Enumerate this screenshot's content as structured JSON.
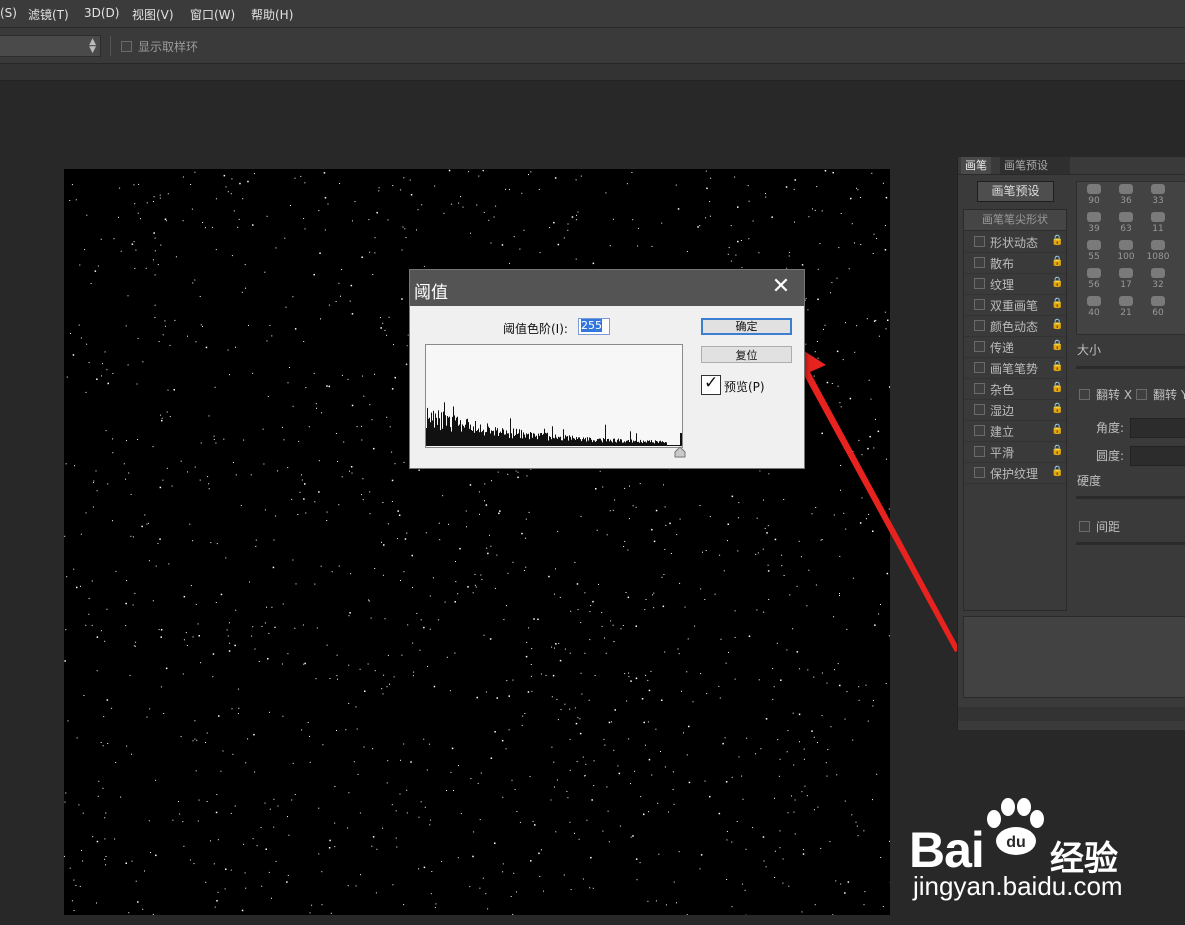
{
  "menu": [
    "(S)",
    "滤镜(T)",
    "3D(D)",
    "视图(V)",
    "窗口(W)",
    "帮助(H)"
  ],
  "options_bar": {
    "show_sampling_ring": "显示取样环"
  },
  "dialog": {
    "title": "阈值",
    "close_glyph": "✕",
    "level_label": "阈值色阶(I):",
    "level_value": "255",
    "ok_label": "确定",
    "reset_label": "复位",
    "preview_label": "预览(P)",
    "preview_checked": true,
    "check_glyph": "✓"
  },
  "brush_panel": {
    "tabs": [
      "画笔",
      "画笔预设"
    ],
    "preset_button": "画笔预设",
    "tip_shape_header": "画笔笔尖形状",
    "options": [
      "形状动态",
      "散布",
      "纹理",
      "双重画笔",
      "颜色动态",
      "传递",
      "画笔笔势",
      "杂色",
      "湿边",
      "建立",
      "平滑",
      "保护纹理"
    ],
    "lock_glyph": "🔒",
    "brush_sizes": [
      "90",
      "36",
      "33",
      "39",
      "63",
      "11",
      "55",
      "100",
      "1080",
      "56",
      "17",
      "32",
      "40",
      "21",
      "60"
    ],
    "size_label": "大小",
    "flip_x": "翻转 X",
    "flip_y": "翻转 Y",
    "angle_label": "角度:",
    "roundness_label": "圆度:",
    "hardness_label": "硬度",
    "spacing_label": "间距"
  },
  "watermark": {
    "bai": "Bai",
    "du": "du",
    "jingyan": "经验",
    "url": "jingyan.baidu.com"
  },
  "colors": {
    "annotation_arrow": "#e8231f",
    "canvas": "#000000",
    "selection_blue": "#3377dd"
  }
}
